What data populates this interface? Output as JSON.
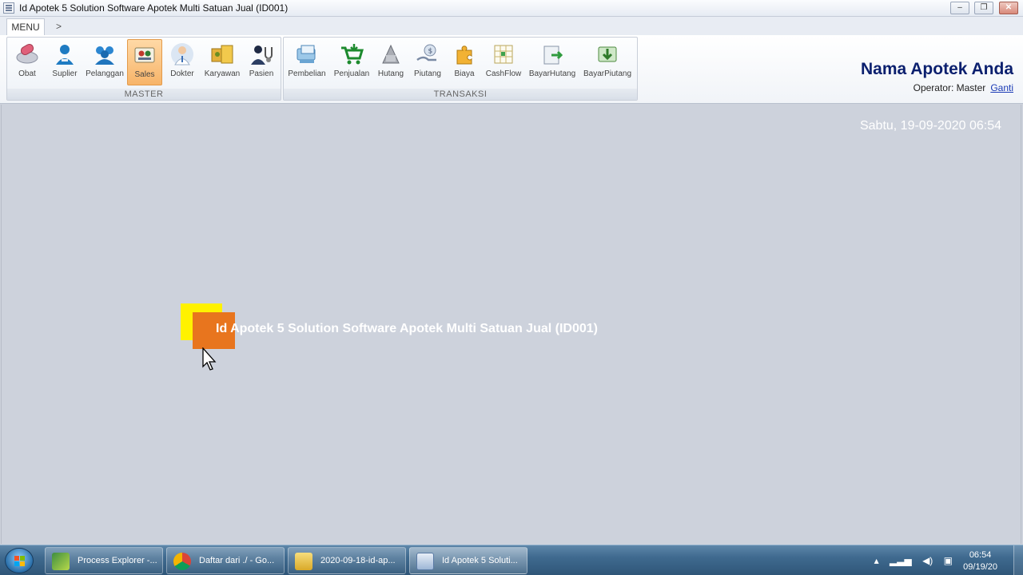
{
  "window": {
    "title": "Id Apotek 5 Solution Software Apotek Multi Satuan Jual (ID001)",
    "min_glyph": "–",
    "max_glyph": "❐",
    "close_glyph": "✕"
  },
  "menu": {
    "tab": "MENU",
    "more": ">"
  },
  "ribbon": {
    "master": {
      "label": "MASTER",
      "items": [
        {
          "label": "Obat",
          "icon": "pill-icon"
        },
        {
          "label": "Suplier",
          "icon": "supplier-icon"
        },
        {
          "label": "Pelanggan",
          "icon": "customers-icon"
        },
        {
          "label": "Sales",
          "icon": "sales-icon",
          "active": true
        },
        {
          "label": "Dokter",
          "icon": "doctor-icon"
        },
        {
          "label": "Karyawan",
          "icon": "employee-icon"
        },
        {
          "label": "Pasien",
          "icon": "patient-icon"
        }
      ]
    },
    "transaksi": {
      "label": "TRANSAKSI",
      "items": [
        {
          "label": "Pembelian",
          "icon": "purchase-icon"
        },
        {
          "label": "Penjualan",
          "icon": "cart-icon"
        },
        {
          "label": "Hutang",
          "icon": "debt-icon"
        },
        {
          "label": "Piutang",
          "icon": "receivable-icon"
        },
        {
          "label": "Biaya",
          "icon": "expense-icon"
        },
        {
          "label": "CashFlow",
          "icon": "cashflow-icon"
        },
        {
          "label": "BayarHutang",
          "icon": "pay-debt-icon"
        },
        {
          "label": "BayarPiutang",
          "icon": "pay-receivable-icon"
        }
      ]
    }
  },
  "header": {
    "store_name": "Nama Apotek Anda",
    "operator_label": "Operator: Master",
    "change_link": "Ganti"
  },
  "main": {
    "datetime": "Sabtu, 19-09-2020 06:54",
    "splash_title": "Id Apotek 5 Solution Software Apotek Multi Satuan Jual (ID001)"
  },
  "taskbar": {
    "items": [
      {
        "label": "Process Explorer -...",
        "icon": "process-explorer-icon"
      },
      {
        "label": "Daftar dari ./ - Go...",
        "icon": "chrome-icon"
      },
      {
        "label": "2020-09-18-id-ap...",
        "icon": "folder-icon"
      },
      {
        "label": "Id Apotek 5 Soluti...",
        "icon": "apotek-app-icon",
        "active": true
      }
    ],
    "clock_time": "06:54",
    "clock_date": "09/19/20"
  },
  "colors": {
    "brand": "#0b1f6e",
    "active_button": "#f7b469",
    "logo_yellow": "#fff200",
    "logo_orange": "#e8751e"
  }
}
